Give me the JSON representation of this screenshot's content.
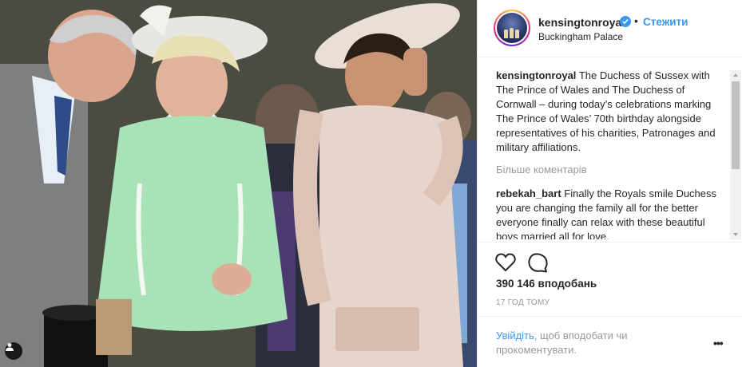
{
  "header": {
    "username": "kensingtonroyal",
    "separator": "•",
    "follow_label": "Стежити",
    "location": "Buckingham Palace"
  },
  "caption": {
    "username": "kensingtonroyal",
    "text": "The Duchess of Sussex with The Prince of Wales and The Duchess of Cornwall – during today’s celebrations marking The Prince of Wales’ 70th birthday alongside representatives of his charities, Patronages and military affiliations."
  },
  "more_comments_label": "Більше коментарів",
  "comments": [
    {
      "username": "rebekah_bart",
      "text": "Finally the Royals smile Duchess you are changing the family all for the better everyone finally can relax with these beautiful boys married all for love."
    }
  ],
  "likes": "390 146 вподобань",
  "timestamp": "17 ГОД ТОМУ",
  "login_prompt": {
    "link": "Увійдіть",
    "text": ", щоб вподобати чи прокоментувати."
  },
  "more_options": "•••",
  "colors": {
    "accent": "#3897f0",
    "verified": "#3897f0",
    "muted": "#999999",
    "text": "#262626"
  },
  "icons": {
    "like": "heart-icon",
    "comment": "comment-icon",
    "verified": "verified-badge-icon",
    "tag": "user-tag-icon",
    "more": "more-options-icon"
  }
}
